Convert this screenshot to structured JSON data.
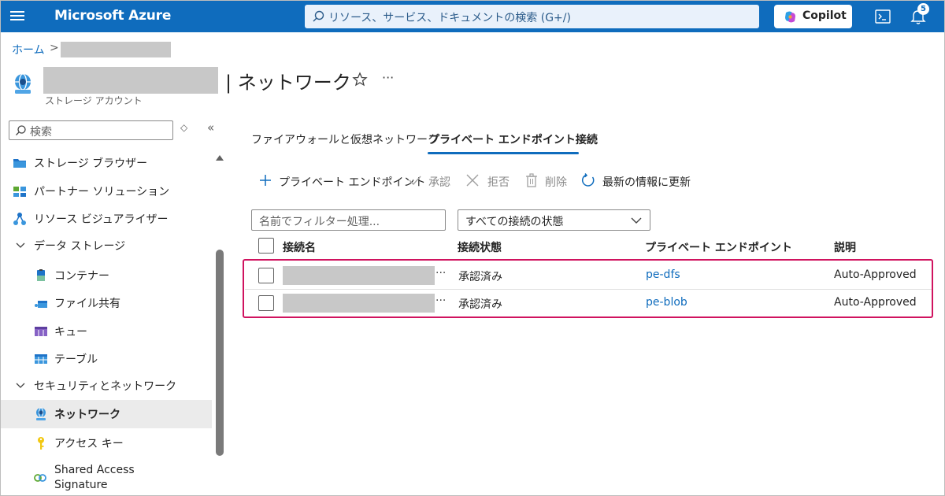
{
  "topbar": {
    "brand": "Microsoft Azure",
    "search_placeholder": "リソース、サービス、ドキュメントの検索 (G+/)",
    "copilot_label": "Copilot",
    "notification_count": "5",
    "bg_color": "#0f6cbd"
  },
  "breadcrumb": {
    "home": "ホーム",
    "separator": ">"
  },
  "header": {
    "title": "| ネットワーク",
    "subtitle": "ストレージ アカウント",
    "more": "···"
  },
  "sidebar": {
    "search_placeholder": "検索",
    "diamond": "◇",
    "collapse": "«",
    "items": [
      {
        "label": "ストレージ ブラウザー",
        "icon": "storage-browser-icon"
      },
      {
        "label": "パートナー ソリューション",
        "icon": "partner-solutions-icon"
      },
      {
        "label": "リソース ビジュアライザー",
        "icon": "resource-visualizer-icon"
      },
      {
        "label": "データ ストレージ",
        "icon": "chevron-down-icon"
      },
      {
        "label": "コンテナー",
        "icon": "container-icon"
      },
      {
        "label": "ファイル共有",
        "icon": "file-share-icon"
      },
      {
        "label": "キュー",
        "icon": "queue-icon"
      },
      {
        "label": "テーブル",
        "icon": "table-icon"
      },
      {
        "label": "セキュリティとネットワーク",
        "icon": "chevron-down-icon"
      },
      {
        "label": "ネットワーク",
        "icon": "network-icon",
        "active": true
      },
      {
        "label": "アクセス キー",
        "icon": "key-icon"
      },
      {
        "label": "Shared Access",
        "icon": "link-icon"
      },
      {
        "label": "Signature"
      }
    ]
  },
  "tabs": [
    {
      "label": "ファイアウォールと仮想ネットワーク",
      "active": false
    },
    {
      "label": "プライベート エンドポイント接続",
      "active": true
    }
  ],
  "toolbar": {
    "add": "プライベート エンドポイント",
    "approve": "承認",
    "reject": "拒否",
    "delete": "削除",
    "refresh": "最新の情報に更新"
  },
  "filters": {
    "name_placeholder": "名前でフィルター処理...",
    "state_value": "すべての接続の状態"
  },
  "table": {
    "columns": [
      "接続名",
      "接続状態",
      "プライベート エンドポイント",
      "説明"
    ],
    "rows": [
      {
        "ellipsis": "···",
        "state": "承認済み",
        "endpoint": "pe-dfs",
        "description": "Auto-Approved"
      },
      {
        "ellipsis": "···",
        "state": "承認済み",
        "endpoint": "pe-blob",
        "description": "Auto-Approved"
      }
    ]
  },
  "colors": {
    "accent": "#0f6cbd",
    "highlight": "#d0135f",
    "redaction": "#c8c8c8"
  }
}
